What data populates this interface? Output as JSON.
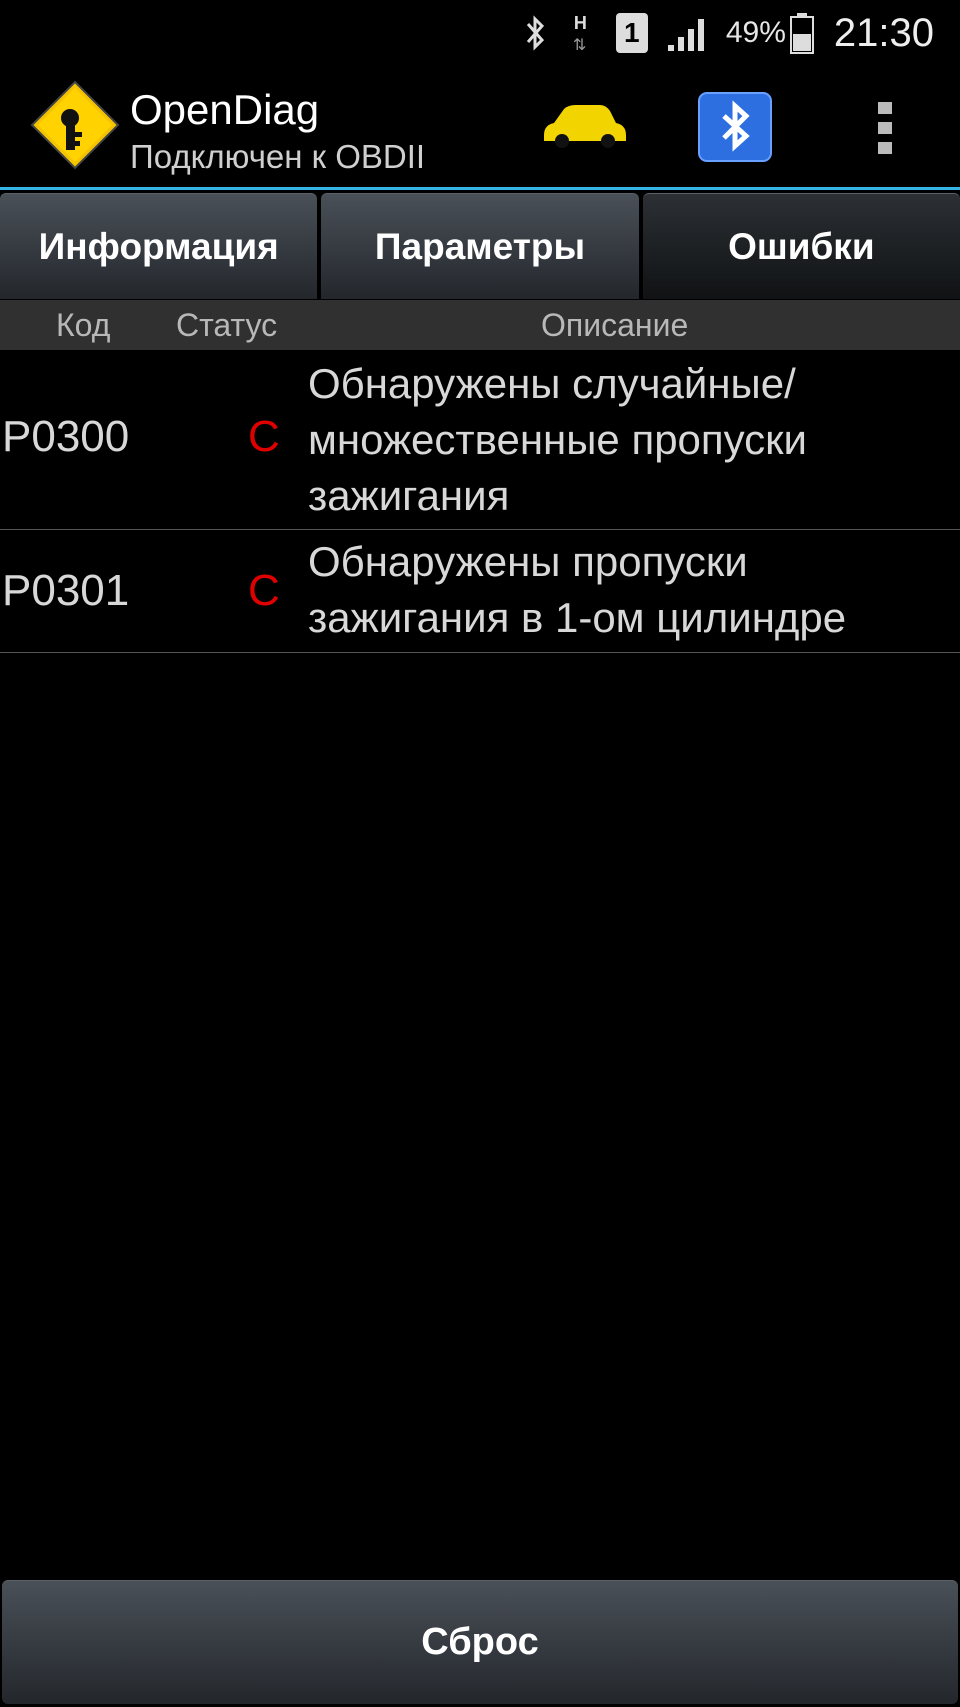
{
  "status_bar": {
    "battery_percent": "49%",
    "time": "21:30",
    "data_type": "H",
    "sim_slot": "1",
    "icons": [
      "bluetooth-icon",
      "data-h-icon",
      "sim-1-icon",
      "signal-icon",
      "battery-icon"
    ]
  },
  "action_bar": {
    "title": "OpenDiag",
    "subtitle": "Подключен к OBDII",
    "icons": [
      "app-logo-icon",
      "car-icon",
      "bluetooth-module-icon",
      "overflow-menu-icon"
    ],
    "accent_color": "#33b5e5",
    "car_color": "#f2d400"
  },
  "tabs": [
    {
      "label": "Информация",
      "active": false
    },
    {
      "label": "Параметры",
      "active": false
    },
    {
      "label": "Ошибки",
      "active": true
    }
  ],
  "table": {
    "columns": {
      "code": "Код",
      "status": "Статус",
      "description": "Описание"
    },
    "rows": [
      {
        "code": "P0300",
        "status": "C",
        "description": "Обнаружены случайные/\nмножественные пропуски\nзажигания"
      },
      {
        "code": "P0301",
        "status": "C",
        "description": "Обнаружены пропуски\nзажигания в 1-ом цилиндре"
      }
    ],
    "status_color": "#e00000"
  },
  "footer": {
    "reset_label": "Сброс"
  }
}
